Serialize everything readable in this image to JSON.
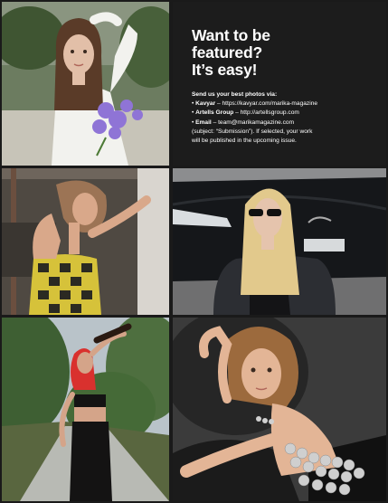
{
  "promo": {
    "title_lines": [
      "Want to be",
      "featured?",
      "It’s easy!"
    ],
    "intro": "Send us your best photos via:",
    "channels": [
      {
        "bullet": "•",
        "name": "Kavyar",
        "detail": " – https://kavyar.com/marika-magazine"
      },
      {
        "bullet": "•",
        "name": "Artells Group",
        "detail": " – http://artellsgroup.com"
      },
      {
        "bullet": "•",
        "name": "Email",
        "detail": " – team@marikamagazine.com"
      }
    ],
    "note_lines": [
      "(subject: “Submission”). If selected, your work",
      "will be published in the upcoming issue."
    ]
  },
  "photos": [
    {
      "id": "photo-woman-white-shirt-flowers",
      "palette": {
        "bg": "#9aa58f",
        "skin": "#e2bfa8",
        "hair": "#5a3b28",
        "cloth": "#f3f3f1",
        "accent": "#8f74d6"
      }
    },
    {
      "id": "photo-woman-checkered-dress",
      "palette": {
        "bg": "#4f4942",
        "skin": "#d9a88a",
        "hair": "#9c7455",
        "cloth": "#d6c23a",
        "accent": "#2b2a22"
      }
    },
    {
      "id": "photo-woman-mustang-car",
      "palette": {
        "bg": "#6f6f70",
        "skin": "#e5c4ad",
        "hair": "#e2c98c",
        "cloth": "#1e1f22",
        "accent": "#15171a"
      }
    },
    {
      "id": "photo-woman-red-hair-bottle",
      "palette": {
        "bg": "#4e6f3f",
        "skin": "#d4a489",
        "hair": "#d9312e",
        "cloth": "#141313",
        "accent": "#b9bcb7"
      }
    },
    {
      "id": "photo-woman-sequin-top",
      "palette": {
        "bg": "#3b3b3b",
        "skin": "#e3b596",
        "hair": "#9c6a3d",
        "cloth": "#c8c8c8",
        "accent": "#1b1b1b"
      }
    }
  ]
}
